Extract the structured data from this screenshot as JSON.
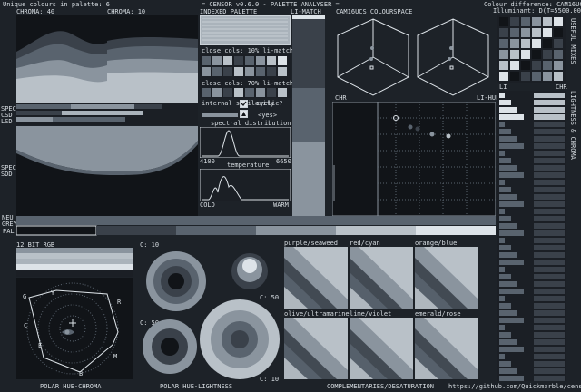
{
  "header": {
    "unique_colours": "Unique colours in palette: 6",
    "app_title": "= CENSOR v0.6.0 - PALETTE ANALYSER =",
    "colour_difference": "Colour difference: CAM16UCS",
    "illuminant": "Illuminant: D(T=5500.00°K)"
  },
  "top_labels": {
    "chroma_40": "CHROMA: 40",
    "chroma_10": "CHROMA: 10",
    "indexed_palette": "INDEXED PALETTE",
    "li_match": "LI-MATCH",
    "cam16ucs": "CAM16UCS COLOURSPACE"
  },
  "left_labels": {
    "spec": "SPEC",
    "csd": "CSD",
    "lsd": "LSD",
    "spec2": "SPEC",
    "sdd": "SDD",
    "neu": "NEU",
    "grey": "GREY",
    "pal": "PAL"
  },
  "palette_panel": {
    "close_cols_1": "close cols: 10% li-match",
    "close_cols_2": "close cols: 70% li-match",
    "internal_similarity": "internal similarity",
    "cyclic": "cyclic?",
    "cyclic_value": "<yes>",
    "spectral_distribution": "spectral distribution",
    "wl_min": "4100",
    "wl_max": "6650",
    "temperature": "temperature",
    "cold": "COLD",
    "warm": "WARM"
  },
  "mid_labels": {
    "chr": "CHR",
    "li_hue": "LI-HUE",
    "li": "LI",
    "chr2": "CHR"
  },
  "right_vertical": {
    "useful_mixes": "USEFUL MIXES",
    "lightness_chroma": "LIGHTNESS & CHROMA"
  },
  "bottom": {
    "rgb12": "12 BIT RGB",
    "c10_a": "C: 10",
    "c50_a": "C: 50",
    "c50_b": "C: 50",
    "c10_b": "C: 10",
    "purple_seaweed": "purple/seaweed",
    "red_cyan": "red/cyan",
    "orange_blue": "orange/blue",
    "olive_ultramarine": "olive/ultramarine",
    "lime_violet": "lime/violet",
    "emerald_rose": "emerald/rose",
    "polar_hue_chroma": "POLAR HUE-CHROMA",
    "polar_hue_lightness": "POLAR HUE-LIGHTNESS",
    "complementaries": "COMPLEMENTARIES/DESATURATION",
    "url": "https://github.com/Quickmarble/censor",
    "hue_letters": [
      "G",
      "Y",
      "R",
      "C",
      "M",
      "B",
      "E"
    ]
  },
  "colors": {
    "bg": "#1d2228",
    "c1": "#111418",
    "c2": "#3a414a",
    "c3": "#59636e",
    "c4": "#8a949e",
    "c5": "#b9c1c8",
    "c6": "#dde3e8"
  }
}
